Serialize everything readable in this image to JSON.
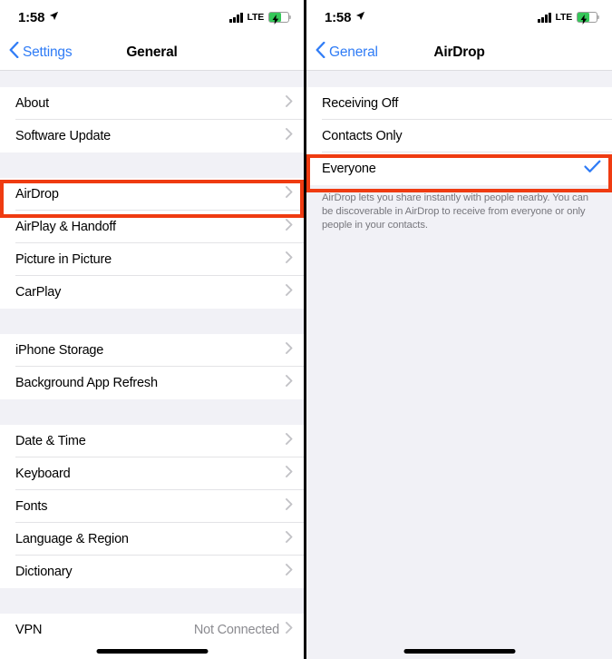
{
  "colors": {
    "highlight": "#ef3b11",
    "accent_blue": "#2f7cf6",
    "check_blue": "#2f7cf6",
    "battery_green": "#35c759",
    "page_background": "#f1f1f6",
    "row_background": "#ffffff"
  },
  "left_screen": {
    "statusbar": {
      "time": "1:58",
      "location_icon": "location-arrow-icon",
      "signal_icon": "cellular-signal-icon",
      "carrier": "LTE",
      "battery_icon": "battery-charging-icon"
    },
    "navbar": {
      "back_label": "Settings",
      "back_icon": "chevron-left-icon",
      "title": "General"
    },
    "sections": [
      {
        "rows": [
          {
            "label": "About",
            "detail": "",
            "accessory": "chevron-right-icon",
            "highlighted": false
          },
          {
            "label": "Software Update",
            "detail": "",
            "accessory": "chevron-right-icon",
            "highlighted": false
          }
        ]
      },
      {
        "rows": [
          {
            "label": "AirDrop",
            "detail": "",
            "accessory": "chevron-right-icon",
            "highlighted": true
          },
          {
            "label": "AirPlay & Handoff",
            "detail": "",
            "accessory": "chevron-right-icon",
            "highlighted": false
          },
          {
            "label": "Picture in Picture",
            "detail": "",
            "accessory": "chevron-right-icon",
            "highlighted": false
          },
          {
            "label": "CarPlay",
            "detail": "",
            "accessory": "chevron-right-icon",
            "highlighted": false
          }
        ]
      },
      {
        "rows": [
          {
            "label": "iPhone Storage",
            "detail": "",
            "accessory": "chevron-right-icon",
            "highlighted": false
          },
          {
            "label": "Background App Refresh",
            "detail": "",
            "accessory": "chevron-right-icon",
            "highlighted": false
          }
        ]
      },
      {
        "rows": [
          {
            "label": "Date & Time",
            "detail": "",
            "accessory": "chevron-right-icon",
            "highlighted": false
          },
          {
            "label": "Keyboard",
            "detail": "",
            "accessory": "chevron-right-icon",
            "highlighted": false
          },
          {
            "label": "Fonts",
            "detail": "",
            "accessory": "chevron-right-icon",
            "highlighted": false
          },
          {
            "label": "Language & Region",
            "detail": "",
            "accessory": "chevron-right-icon",
            "highlighted": false
          },
          {
            "label": "Dictionary",
            "detail": "",
            "accessory": "chevron-right-icon",
            "highlighted": false
          }
        ]
      },
      {
        "rows": [
          {
            "label": "VPN",
            "detail": "Not Connected",
            "accessory": "chevron-right-icon",
            "highlighted": false
          }
        ]
      }
    ],
    "home_indicator": "home-indicator-bar"
  },
  "right_screen": {
    "statusbar": {
      "time": "1:58",
      "location_icon": "location-arrow-icon",
      "signal_icon": "cellular-signal-icon",
      "carrier": "LTE",
      "battery_icon": "battery-charging-icon"
    },
    "navbar": {
      "back_label": "General",
      "back_icon": "chevron-left-icon",
      "title": "AirDrop"
    },
    "options": [
      {
        "label": "Receiving Off",
        "selected": false,
        "highlighted": false
      },
      {
        "label": "Contacts Only",
        "selected": false,
        "highlighted": false
      },
      {
        "label": "Everyone",
        "selected": true,
        "highlighted": true
      }
    ],
    "footnote": "AirDrop lets you share instantly with people nearby. You can be discoverable in AirDrop to receive from everyone or only people in your contacts.",
    "home_indicator": "home-indicator-bar"
  }
}
